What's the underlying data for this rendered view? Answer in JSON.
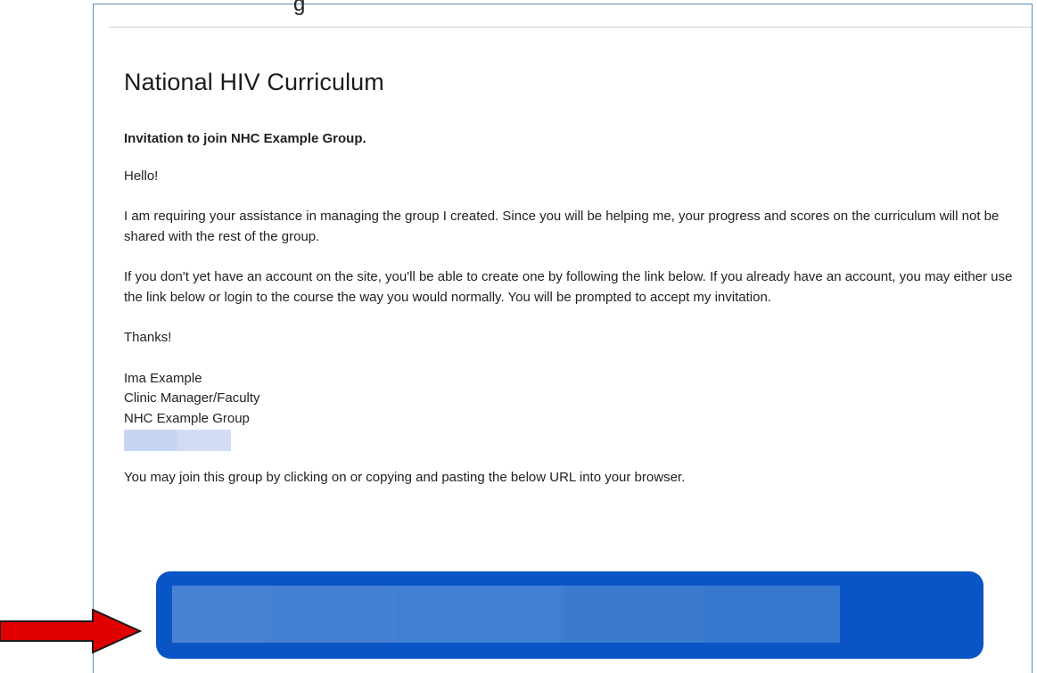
{
  "email": {
    "brand_title": "National HIV Curriculum",
    "subject": "Invitation to join NHC Example Group.",
    "greeting": "Hello!",
    "paragraph_1": "I am requiring your assistance in managing the group I created. Since you will be helping me, your progress and scores on the curriculum will not be shared with the rest of the group.",
    "paragraph_2": "If you don't yet have an account on the site, you'll be able to create one by following the link below. If you already have an account, you may either use the link below or login to the course the way you would normally. You will be prompted to accept my invitation.",
    "closing": "Thanks!",
    "signature": {
      "name": "Ima Example",
      "role": "Clinic Manager/Faculty",
      "group": "NHC Example Group"
    },
    "join_instructions": "You may join this group by clicking on or copying and pasting the below URL into your browser."
  },
  "colors": {
    "panel_border": "#5e8bb0",
    "join_button": "#0a55c6",
    "arrow": "#e00000"
  },
  "icons": {
    "pointer_arrow": "red-right-arrow-icon"
  }
}
